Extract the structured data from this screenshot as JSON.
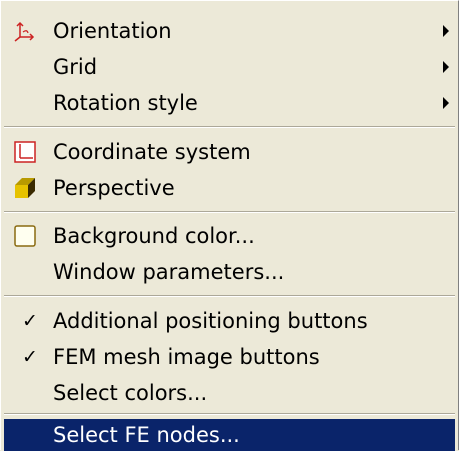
{
  "menu": {
    "items": [
      {
        "label": "Orientation",
        "icon": "orientation-axes-icon",
        "submenu": true
      },
      {
        "label": "Grid",
        "submenu": true
      },
      {
        "label": "Rotation style",
        "submenu": true
      },
      {
        "label": "Coordinate system",
        "icon": "coordinate-system-icon"
      },
      {
        "label": "Perspective",
        "icon": "perspective-cube-icon"
      },
      {
        "label": "Background color...",
        "icon": "color-swatch-icon"
      },
      {
        "label": "Window parameters..."
      },
      {
        "label": "Additional positioning buttons",
        "checked": true
      },
      {
        "label": "FEM mesh image buttons",
        "checked": true
      },
      {
        "label": "Select colors..."
      },
      {
        "label": "Select FE nodes...",
        "highlighted": true
      }
    ]
  },
  "colors": {
    "menu_background": "#ece9d8",
    "highlight_background": "#0a246a",
    "highlight_text": "#ffffff",
    "separator": "#aca899",
    "icon_red": "#cc2222",
    "cube_yellow": "#e6c200",
    "cube_dark": "#3a2a00"
  }
}
